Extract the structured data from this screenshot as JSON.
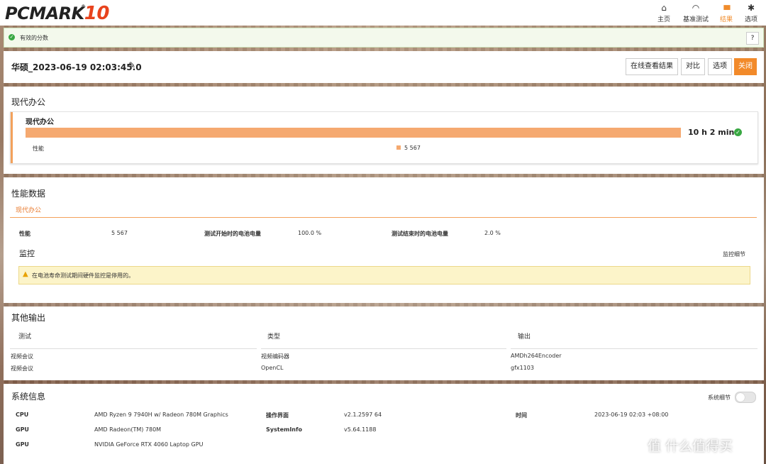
{
  "app": {
    "logo_main": "PCMARK",
    "logo_num": "10",
    "logo_reg": "®"
  },
  "nav": [
    {
      "icon": "home-icon",
      "glyph": "⌂",
      "label": "主页"
    },
    {
      "icon": "gauge-icon",
      "glyph": "◠",
      "label": "基准测试"
    },
    {
      "icon": "bar-chart-icon",
      "glyph": "▮▮▮",
      "label": "结果"
    },
    {
      "icon": "gear-icon",
      "glyph": "✱",
      "label": "选项"
    }
  ],
  "status": {
    "label": "有效的分数",
    "help": "?"
  },
  "result": {
    "title": "华硕_2023-06-19 02:03:45.0",
    "buttons": {
      "online": "在线查看结果",
      "compare": "对比",
      "options": "选项",
      "close": "关闭"
    }
  },
  "summary": {
    "section_title": "现代办公",
    "card_title": "现代办公",
    "score_text": "10 h 2 min",
    "bar_fraction": 1.0,
    "perf_label": "性能",
    "perf_value": "5 567"
  },
  "perf_data": {
    "section_title": "性能数据",
    "tab": "现代办公",
    "row": [
      {
        "label": "性能",
        "value": "5 567"
      },
      {
        "label": "测试开始时的电池电量",
        "value": "100.0 %"
      },
      {
        "label": "测试结束时的电池电量",
        "value": "2.0 %"
      }
    ],
    "monitor_title": "监控",
    "monitor_link": "监控细节",
    "warning": "在电池寿命测试期间硬件监控是停用的。"
  },
  "other_output": {
    "section_title": "其他输出",
    "headers": [
      "测试",
      "类型",
      "输出"
    ],
    "rows": [
      [
        "视频会议",
        "视频编码器",
        "AMDh264Encoder"
      ],
      [
        "视频会议",
        "OpenCL",
        "gfx1103"
      ]
    ]
  },
  "sysinfo": {
    "section_title": "系统信息",
    "toggle_label": "系统细节",
    "col1": [
      {
        "label": "CPU",
        "value": "AMD Ryzen 9 7940H w/ Radeon 780M Graphics"
      },
      {
        "label": "GPU",
        "value": "AMD Radeon(TM) 780M"
      },
      {
        "label": "GPU",
        "value": "NVIDIA GeForce RTX 4060 Laptop GPU"
      }
    ],
    "col2": [
      {
        "label": "操作界面",
        "value": "v2.1.2597 64"
      },
      {
        "label": "SystemInfo",
        "value": "v5.64.1188"
      }
    ],
    "col3": [
      {
        "label": "时间",
        "value": "2023-06-19 02:03 +08:00"
      }
    ]
  },
  "watermark": "值 什么值得买",
  "colors": {
    "accent": "#f28a2a",
    "bar": "#f5a970",
    "valid": "#39a843"
  }
}
